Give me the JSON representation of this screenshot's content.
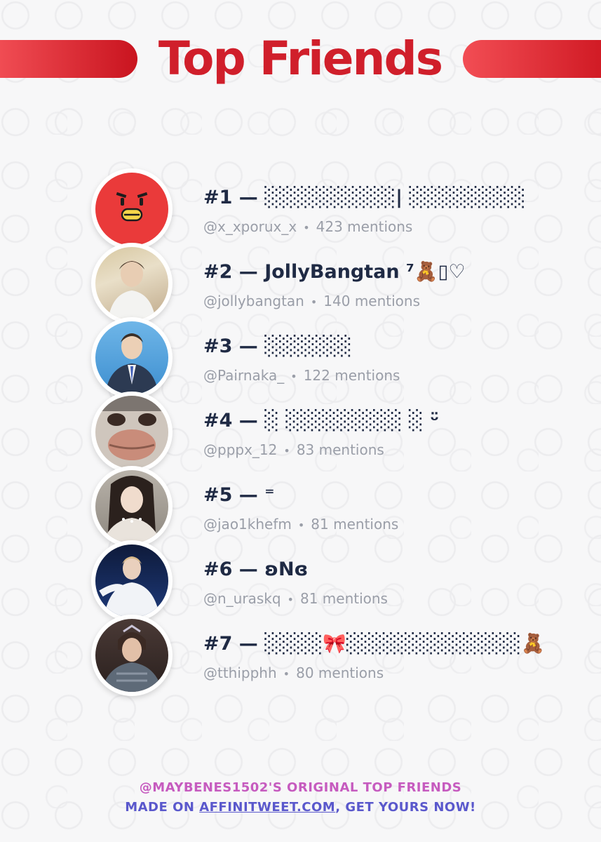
{
  "header": {
    "title": "Top Friends"
  },
  "friends": [
    {
      "rank": "#1",
      "display_name": "#1 — ░░░░░░░░░| ░░░░░░░░",
      "handle": "@x_xporux_x",
      "mentions": "423 mentions",
      "avatar_icon": "red-bird-mascot"
    },
    {
      "rank": "#2",
      "display_name": "#2 — JollyBangtan ⁷🧸▯♡",
      "handle": "@jollybangtan",
      "mentions": "140 mentions",
      "avatar_icon": "person-photo"
    },
    {
      "rank": "#3",
      "display_name": "#3 — ░░░░░░",
      "handle": "@Pairnaka_",
      "mentions": "122 mentions",
      "avatar_icon": "person-photo"
    },
    {
      "rank": "#4",
      "display_name": "#4 — ░ ░░░░░░░░ ░ ᵕ̈",
      "handle": "@pppx_12",
      "mentions": "83 mentions",
      "avatar_icon": "person-photo"
    },
    {
      "rank": "#5",
      "display_name": "#5 — ⁼",
      "handle": "@jao1khefm",
      "mentions": "81 mentions",
      "avatar_icon": "person-photo"
    },
    {
      "rank": "#6",
      "display_name": "#6 — ʚNɞ",
      "handle": "@n_uraskq",
      "mentions": "81 mentions",
      "avatar_icon": "person-photo"
    },
    {
      "rank": "#7",
      "display_name": "#7 — ░░░░🎀░░░░░░░░░░░░🧸",
      "handle": "@tthipphh",
      "mentions": "80 mentions",
      "avatar_icon": "person-photo"
    }
  ],
  "footer": {
    "line1": "@MAYBENES1502'S ORIGINAL TOP FRIENDS",
    "line2_prefix": "MADE ON ",
    "line2_link": "AFFINITWEET.COM",
    "line2_suffix": ", GET YOURS NOW!"
  },
  "colors": {
    "accent_red": "#d01f2b",
    "text_dark": "#1f2a44",
    "text_muted": "#9a9ea8",
    "footer_pink": "#c65bbf",
    "footer_blue": "#5a58cc"
  }
}
